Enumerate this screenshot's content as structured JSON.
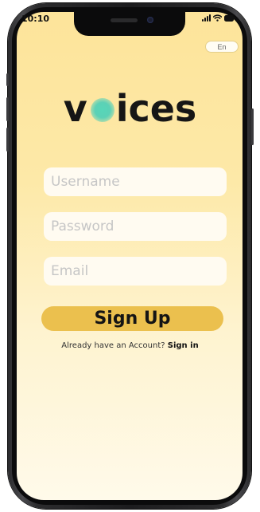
{
  "status_bar": {
    "time": "10:10",
    "icons": [
      "signal-icon",
      "wifi-icon",
      "battery-icon"
    ]
  },
  "language_button": {
    "label": "En"
  },
  "logo": {
    "prefix": "v",
    "suffix": "ices",
    "accent_color": "#5cd1b6"
  },
  "form": {
    "username_placeholder": "Username",
    "password_placeholder": "Password",
    "email_placeholder": "Email",
    "signup_label": "Sign Up"
  },
  "signin": {
    "prompt": "Already have an Account?",
    "link_label": "Sign in"
  },
  "colors": {
    "background_top": "#fde49a",
    "background_bottom": "#fffaea",
    "button": "#ebc04e",
    "field": "#fffbf1"
  }
}
